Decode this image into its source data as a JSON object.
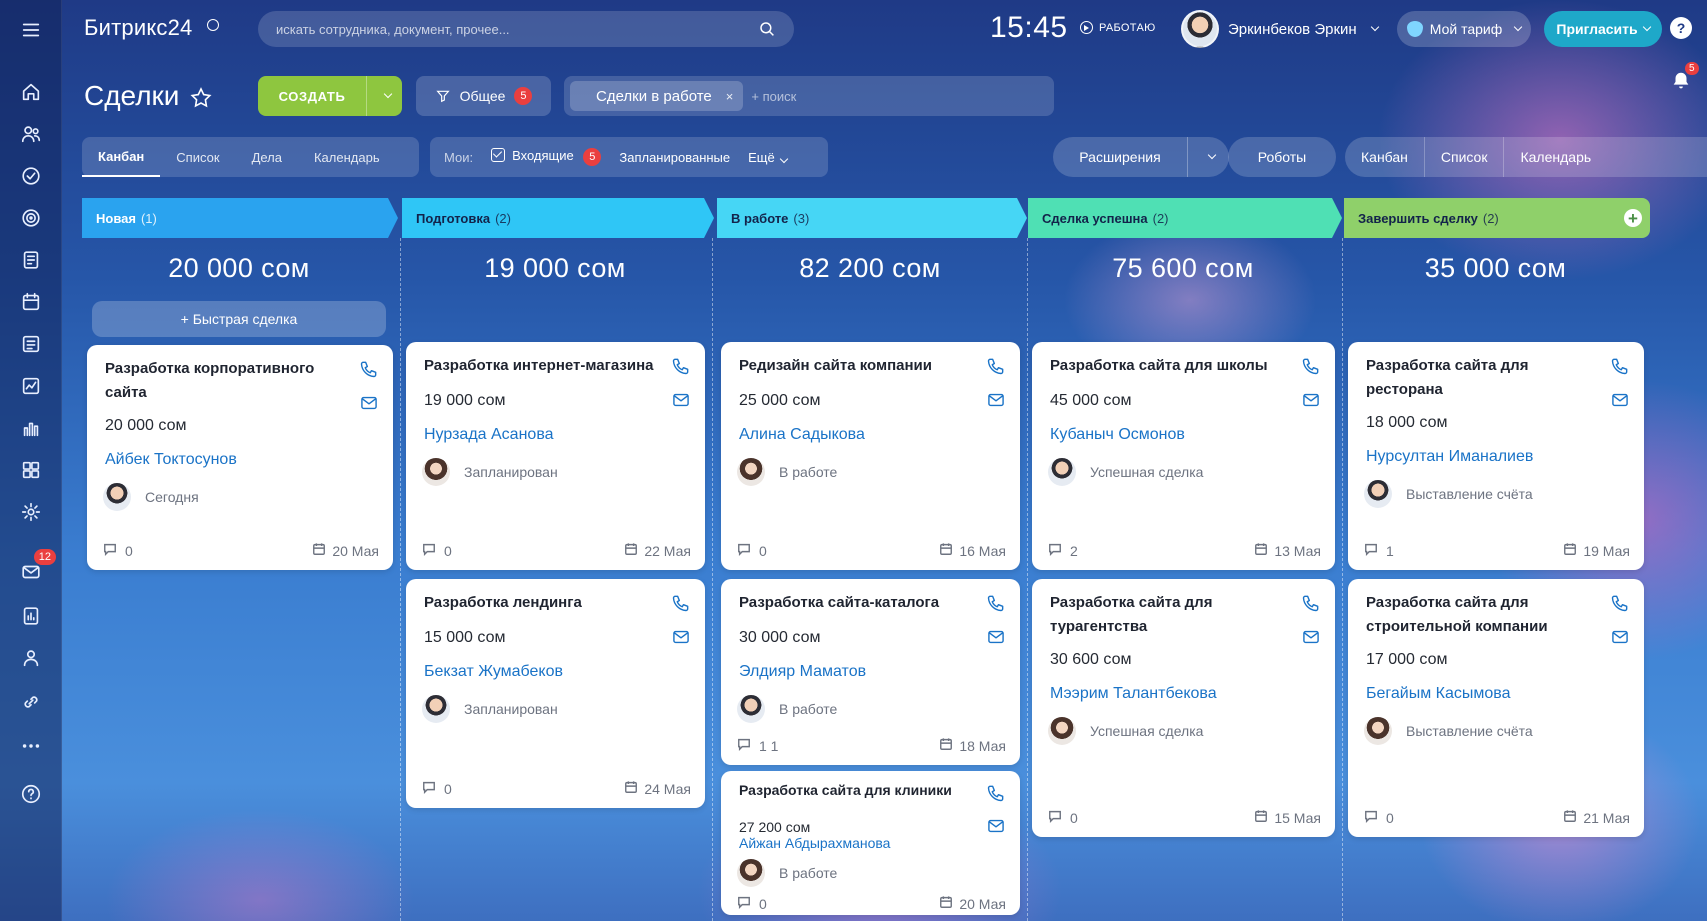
{
  "app": {
    "logo": "Битрикс24",
    "search_placeholder": "искать сотрудника, документ, прочее...",
    "time": "15:45",
    "work_status": "РАБОТАЮ",
    "user_name": "Эркинбеков Эркин",
    "tariff": "Мой тариф",
    "invite": "Пригласить",
    "help": "?",
    "notifications_count": "5",
    "mail_badge": "12"
  },
  "toolbar": {
    "title": "Сделки",
    "create": "СОЗДАТЬ",
    "filter_label": "Общее",
    "filter_count": "5",
    "active_filter": "Сделки в работе",
    "active_filter_remove": "×",
    "search_placeholder": "+ поиск"
  },
  "views": {
    "tabs": [
      "Канбан",
      "Список",
      "Дела",
      "Календарь"
    ],
    "active": "Канбан"
  },
  "my_bar": {
    "label": "Мои:",
    "incoming": "Входящие",
    "incoming_count": "5",
    "planned": "Запланированные",
    "more": "Ещё"
  },
  "right_bar": {
    "extensions": "Расширения",
    "robots": "Роботы",
    "view_tabs": [
      "Канбан",
      "Список",
      "Календарь"
    ]
  },
  "columns": [
    {
      "title": "Новая",
      "count": "(1)",
      "sum": "20 000 сом",
      "color": "#2aa3ef",
      "quick_deal": "+ Быстрая сделка",
      "cards": [
        {
          "title": "Разработка корпоративного сайта",
          "amount": "20 000 сом",
          "client": "Айбек Токтосунов",
          "status": "Сегодня",
          "avatar": "m",
          "comments": "0",
          "date": "20 Мая"
        }
      ]
    },
    {
      "title": "Подготовка",
      "count": "(2)",
      "sum": "19 000 сом",
      "color": "#2fc6f6",
      "cards": [
        {
          "title": "Разработка интернет-магазина",
          "amount": "19 000 сом",
          "client": "Нурзада Асанова",
          "status": "Запланирован",
          "avatar": "f",
          "comments": "0",
          "date": "22 Мая"
        },
        {
          "title": "Разработка лендинга",
          "amount": "15 000 сом",
          "client": "Бекзат Жумабеков",
          "status": "Запланирован",
          "avatar": "m",
          "comments": "0",
          "date": "24 Мая"
        }
      ]
    },
    {
      "title": "В работе",
      "count": "(3)",
      "sum": "82 200 сом",
      "color": "#46d6f5",
      "cards": [
        {
          "title": "Редизайн сайта компании",
          "amount": "25 000 сом",
          "client": "Алина Садыкова",
          "status": "В работе",
          "avatar": "f",
          "comments": "0",
          "date": "16 Мая"
        },
        {
          "title": "Разработка сайта-каталога",
          "amount": "30 000 сом",
          "client": "Элдияр Маматов",
          "status": "В работе",
          "avatar": "m",
          "comments": "1 1",
          "date": "18 Мая"
        },
        {
          "title": "Разработка сайта для клиники",
          "amount": "27 200 сом",
          "client": "Айжан Абдырахманова",
          "status": "В работе",
          "avatar": "f",
          "comments": "0",
          "date": "20 Мая"
        }
      ]
    },
    {
      "title": "Сделка успешна",
      "count": "(2)",
      "sum": "75 600 сом",
      "color": "#4fe0b4",
      "cards": [
        {
          "title": "Разработка сайта для школы",
          "amount": "45 000 сом",
          "client": "Кубаныч Осмонов",
          "status": "Успешная сделка",
          "avatar": "m",
          "comments": "2",
          "date": "13 Мая"
        },
        {
          "title": "Разработка сайта для турагентства",
          "amount": "30 600 сом",
          "client": "Мээрим Талантбекова",
          "status": "Успешная сделка",
          "avatar": "f",
          "comments": "0",
          "date": "15 Мая"
        }
      ]
    },
    {
      "title": "Завершить сделку",
      "count": "(2)",
      "sum": "35 000 сом",
      "color": "#8fd06a",
      "cards": [
        {
          "title": "Разработка сайта для ресторана",
          "amount": "18 000 сом",
          "client": "Нурсултан Иманалиев",
          "status": "Выставление счёта",
          "avatar": "m",
          "comments": "1",
          "date": "19 Мая"
        },
        {
          "title": "Разработка сайта для строительной компании",
          "amount": "17 000 сом",
          "client": "Бегайым Касымова",
          "status": "Выставление счёта",
          "avatar": "f",
          "comments": "0",
          "date": "21 Мая"
        }
      ]
    }
  ]
}
